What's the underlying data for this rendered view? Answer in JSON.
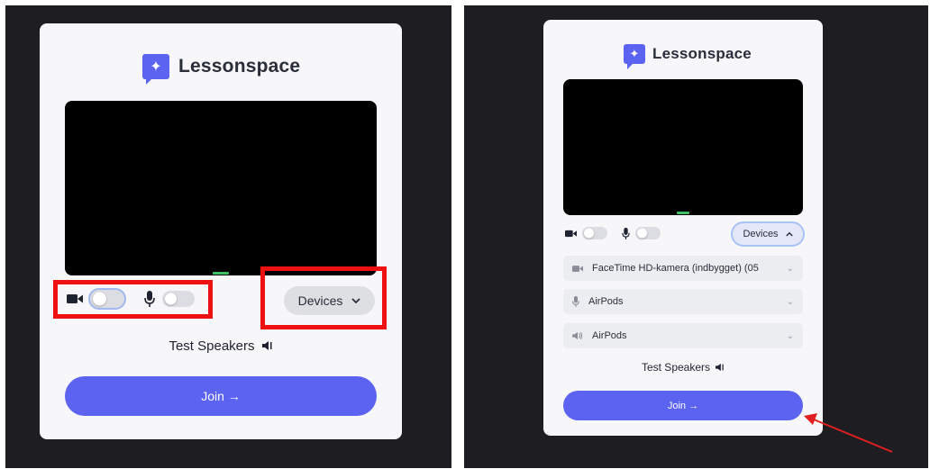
{
  "brand": {
    "name": "Lessonspace",
    "color": "#5b63f0"
  },
  "left": {
    "devices_label": "Devices",
    "test_speakers_label": "Test Speakers",
    "join_label": "Join →"
  },
  "right": {
    "devices_label": "Devices",
    "camera_device": "FaceTime HD-kamera (indbygget) (05",
    "microphone_device": "AirPods",
    "speaker_device": "AirPods",
    "test_speakers_label": "Test Speakers",
    "join_label": "Join →"
  },
  "colors": {
    "highlight": "#ee1111",
    "arrow": "#e02020",
    "video_indicator": "#3fbf62"
  }
}
